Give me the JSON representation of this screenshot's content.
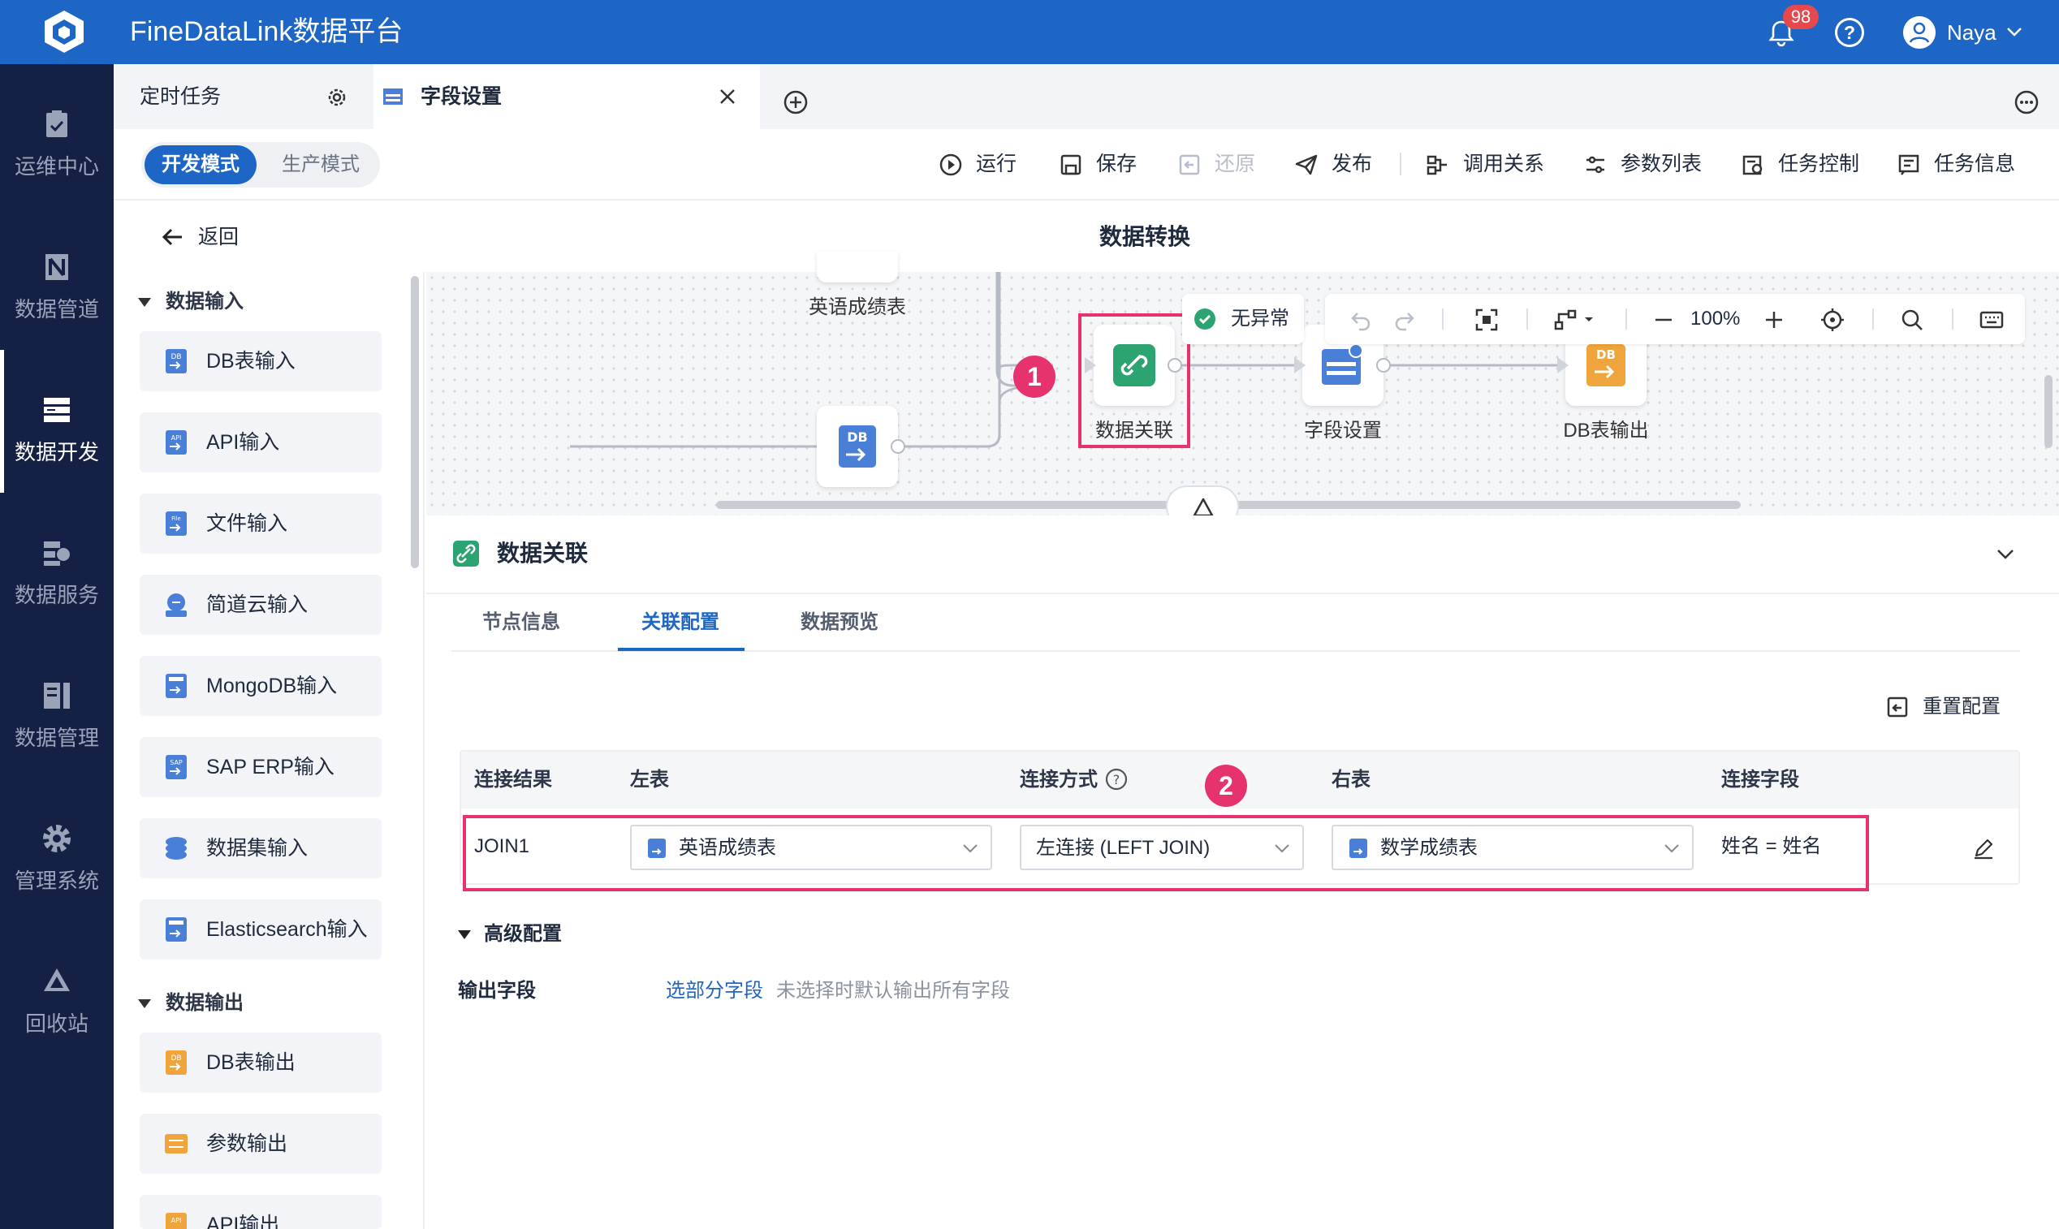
{
  "app": {
    "title": "FineDataLink数据平台",
    "notification_count": "98",
    "user": "Naya"
  },
  "nav": {
    "items": [
      {
        "label": "运维中心"
      },
      {
        "label": "数据管道"
      },
      {
        "label": "数据开发"
      },
      {
        "label": "数据服务"
      },
      {
        "label": "数据管理"
      },
      {
        "label": "管理系统"
      },
      {
        "label": "回收站"
      }
    ],
    "active": "数据开发"
  },
  "tabs": {
    "task_tab": "定时任务",
    "field_tab": "字段设置"
  },
  "mode": {
    "dev": "开发模式",
    "prod": "生产模式"
  },
  "toolbar": {
    "run": "运行",
    "save": "保存",
    "restore": "还原",
    "publish": "发布",
    "call_relation": "调用关系",
    "params": "参数列表",
    "task_control": "任务控制",
    "task_info": "任务信息"
  },
  "header": {
    "back": "返回",
    "title": "数据转换"
  },
  "palette": {
    "input_section": "数据输入",
    "inputs": [
      "DB表输入",
      "API输入",
      "文件输入",
      "简道云输入",
      "MongoDB输入",
      "SAP ERP输入",
      "数据集输入",
      "Elasticsearch输入"
    ],
    "output_section": "数据输出",
    "outputs": [
      "DB表输出",
      "参数输出",
      "API输出"
    ]
  },
  "flow": {
    "nodes": {
      "english": "英语成绩表",
      "join": "数据关联",
      "fields": "字段设置",
      "dbout": "DB表输出"
    },
    "status": "无异常",
    "zoom": "100%"
  },
  "markers": [
    "1",
    "2"
  ],
  "panel": {
    "title": "数据关联",
    "subtabs": [
      "节点信息",
      "关联配置",
      "数据预览"
    ],
    "active_subtab": "关联配置",
    "reset": "重置配置",
    "columns": {
      "result": "连接结果",
      "left": "左表",
      "method": "连接方式",
      "right": "右表",
      "field": "连接字段"
    },
    "row": {
      "result": "JOIN1",
      "left": "英语成绩表",
      "method": "左连接 (LEFT JOIN)",
      "right": "数学成绩表",
      "field": "姓名 = 姓名"
    },
    "advanced": "高级配置",
    "output_label": "输出字段",
    "output_link": "选部分字段",
    "output_hint": "未选择时默认输出所有字段"
  },
  "colors": {
    "primary": "#1e66c5",
    "nav_bg": "#142145",
    "highlight": "#e6336e",
    "success": "#2ba471"
  }
}
